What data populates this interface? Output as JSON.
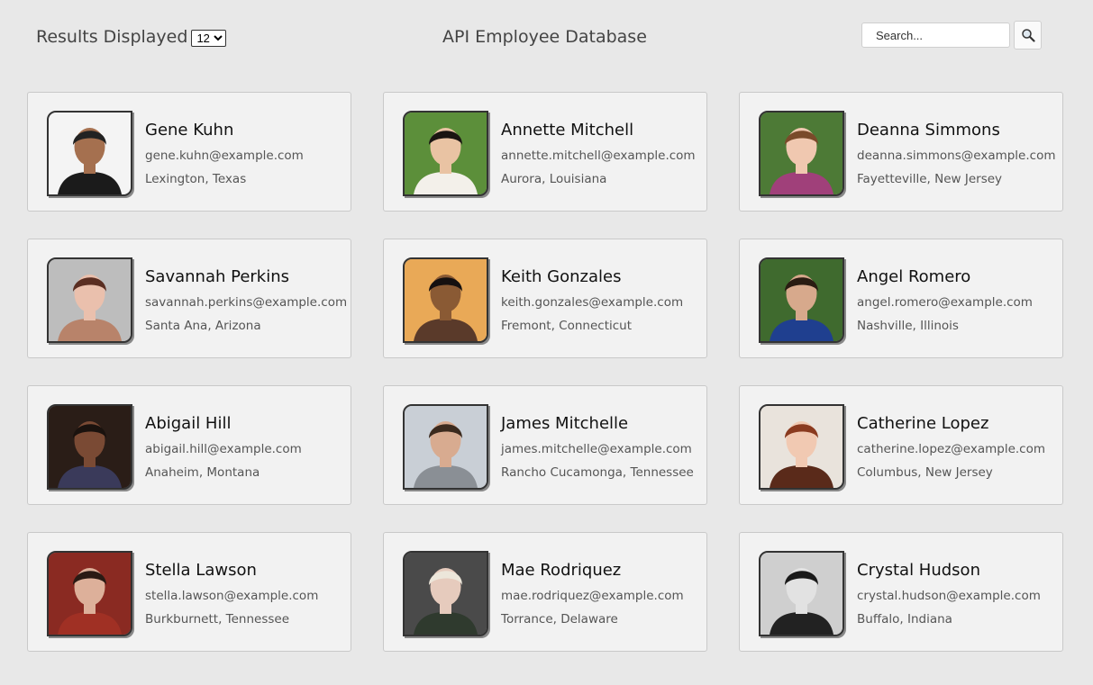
{
  "header": {
    "results_label": "Results Displayed",
    "results_value": "12",
    "title": "API Employee Database",
    "search_placeholder": "Search..."
  },
  "employees": [
    {
      "name": "Gene Kuhn",
      "email": "gene.kuhn@example.com",
      "location": "Lexington, Texas",
      "bg": "#f4f4f4",
      "skin": "#a5704f",
      "hair": "#222222",
      "shirt": "#1b1b1b"
    },
    {
      "name": "Annette Mitchell",
      "email": "annette.mitchell@example.com",
      "location": "Aurora, Louisiana",
      "bg": "#5c8f3a",
      "skin": "#e9c3a3",
      "hair": "#1a1512",
      "shirt": "#f3f0ea"
    },
    {
      "name": "Deanna Simmons",
      "email": "deanna.simmons@example.com",
      "location": "Fayetteville, New Jersey",
      "bg": "#4d7a36",
      "skin": "#f0c8b0",
      "hair": "#7a4a2a",
      "shirt": "#a0407a"
    },
    {
      "name": "Savannah Perkins",
      "email": "savannah.perkins@example.com",
      "location": "Santa Ana, Arizona",
      "bg": "#bdbdbd",
      "skin": "#eac0ad",
      "hair": "#5a2e22",
      "shirt": "#b8836a"
    },
    {
      "name": "Keith Gonzales",
      "email": "keith.gonzales@example.com",
      "location": "Fremont, Connecticut",
      "bg": "#e9a957",
      "skin": "#8a5a34",
      "hair": "#151010",
      "shirt": "#5a3a2a"
    },
    {
      "name": "Angel Romero",
      "email": "angel.romero@example.com",
      "location": "Nashville, Illinois",
      "bg": "#3f6a2e",
      "skin": "#d7a98c",
      "hair": "#2a1c12",
      "shirt": "#1f3f8f"
    },
    {
      "name": "Abigail Hill",
      "email": "abigail.hill@example.com",
      "location": "Anaheim, Montana",
      "bg": "#2a1d17",
      "skin": "#7a4a34",
      "hair": "#1a120e",
      "shirt": "#3a3a5a"
    },
    {
      "name": "James Mitchelle",
      "email": "james.mitchelle@example.com",
      "location": "Rancho Cucamonga, Tennessee",
      "bg": "#c9cfd6",
      "skin": "#d8ab90",
      "hair": "#3b2a1e",
      "shirt": "#8a8f95"
    },
    {
      "name": "Catherine Lopez",
      "email": "catherine.lopez@example.com",
      "location": "Columbus, New Jersey",
      "bg": "#e9e3dc",
      "skin": "#f1c9b2",
      "hair": "#8a3a1f",
      "shirt": "#5a2a1a"
    },
    {
      "name": "Stella Lawson",
      "email": "stella.lawson@example.com",
      "location": "Burkburnett, Tennessee",
      "bg": "#8a2a22",
      "skin": "#ddb09a",
      "hair": "#2a1a14",
      "shirt": "#a03024"
    },
    {
      "name": "Mae Rodriquez",
      "email": "mae.rodriquez@example.com",
      "location": "Torrance, Delaware",
      "bg": "#4a4a4a",
      "skin": "#e6cbbd",
      "hair": "#ece6da",
      "shirt": "#2f3a2e"
    },
    {
      "name": "Crystal Hudson",
      "email": "crystal.hudson@example.com",
      "location": "Buffalo, Indiana",
      "bg": "#cfcfcf",
      "skin": "#e2e2e2",
      "hair": "#1a1a1a",
      "shirt": "#222222"
    }
  ]
}
